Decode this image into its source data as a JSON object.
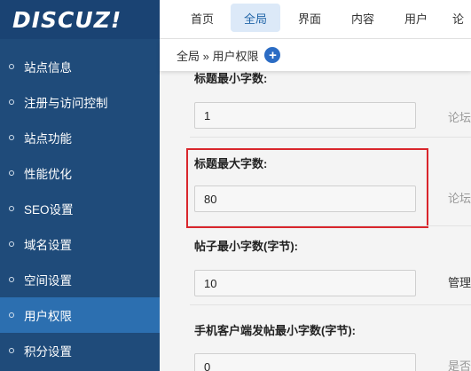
{
  "logo": "DISCUZ!",
  "top_tabs": [
    "首页",
    "全局",
    "界面",
    "内容",
    "用户",
    "论"
  ],
  "breadcrumb": "全局 » 用户权限",
  "sidebar": {
    "items": [
      "站点信息",
      "注册与访问控制",
      "站点功能",
      "性能优化",
      "SEO设置",
      "域名设置",
      "空间设置",
      "用户权限",
      "积分设置"
    ],
    "active": "用户权限"
  },
  "form": {
    "fields": [
      {
        "label": "标题最小字数:",
        "value": "1",
        "hint": "论坛"
      },
      {
        "label": "标题最大字数:",
        "value": "80",
        "hint": "论坛"
      },
      {
        "label": "帖子最小字数(字节):",
        "value": "10",
        "hint": "管理"
      },
      {
        "label": "手机客户端发帖最小字数(字节):",
        "value": "0",
        "hint": "是否"
      }
    ]
  },
  "colors": {
    "sidebar_bg": "#1f4b7a",
    "sidebar_active": "#2c6fb0",
    "tab_active_bg": "#dce9f8",
    "highlight": "#d9262c"
  }
}
